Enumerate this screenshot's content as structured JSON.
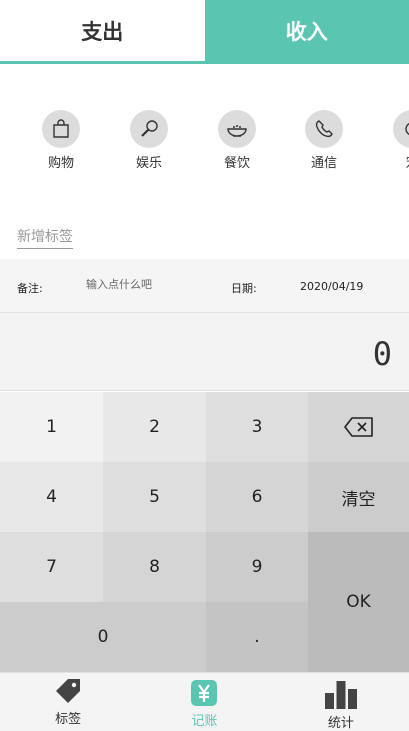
{
  "type_tabs": {
    "expense": "支出",
    "income": "收入"
  },
  "categories": [
    {
      "label": "购物",
      "icon": "shopping-bag-icon"
    },
    {
      "label": "娱乐",
      "icon": "microphone-icon"
    },
    {
      "label": "餐饮",
      "icon": "food-bowl-icon"
    },
    {
      "label": "通信",
      "icon": "phone-icon"
    },
    {
      "label": "宠",
      "icon": "pet-icon"
    }
  ],
  "add_tag": "新增标签",
  "note": {
    "label": "备注:",
    "placeholder": "输入点什么吧"
  },
  "date": {
    "label": "日期:",
    "value": "2020/04/19"
  },
  "amount": "0",
  "keypad": {
    "k1": "1",
    "k2": "2",
    "k3": "3",
    "k4": "4",
    "k5": "5",
    "k6": "6",
    "k7": "7",
    "k8": "8",
    "k9": "9",
    "k0": "0",
    "dot": ".",
    "clear": "清空",
    "ok": "OK"
  },
  "nav": [
    {
      "label": "标签",
      "icon": "tag-icon"
    },
    {
      "label": "记账",
      "icon": "yen-icon",
      "active": true
    },
    {
      "label": "统计",
      "icon": "bar-chart-icon"
    }
  ],
  "colors": {
    "accent": "#5ac6b2",
    "icon_bg": "#dcdcdc"
  }
}
